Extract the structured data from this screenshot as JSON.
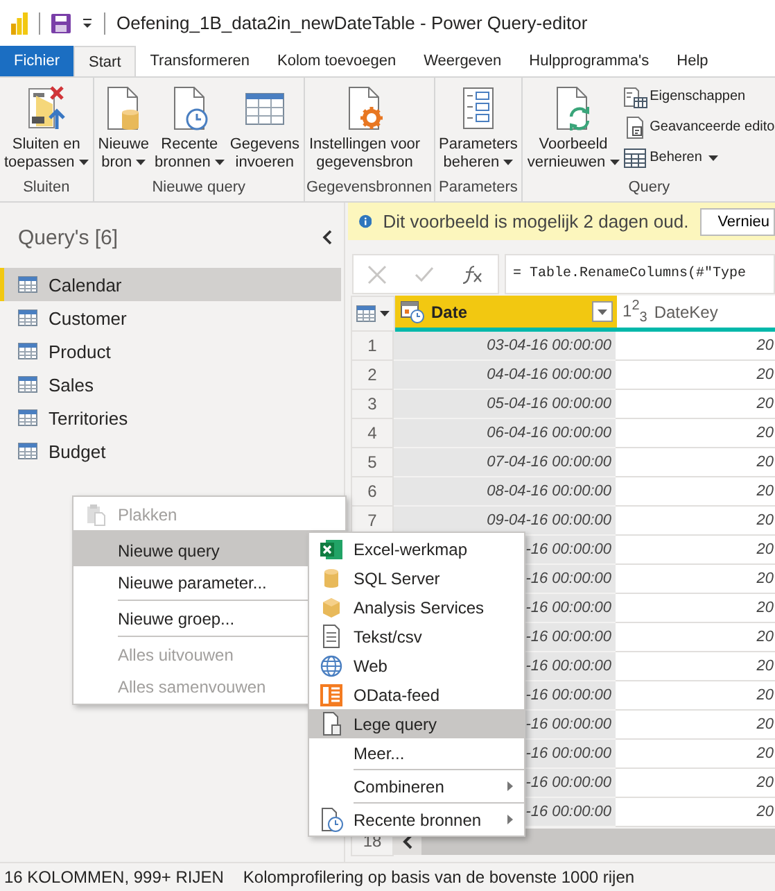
{
  "title_bar": {
    "title": "Oefening_1B_data2in_newDateTable - Power Query-editor"
  },
  "ribbon_tabs": [
    {
      "label": "Fichier",
      "kind": "file",
      "selected": false
    },
    {
      "label": "Start",
      "kind": "tab",
      "selected": true
    },
    {
      "label": "Transformeren",
      "kind": "tab",
      "selected": false
    },
    {
      "label": "Kolom toevoegen",
      "kind": "tab",
      "selected": false
    },
    {
      "label": "Weergeven",
      "kind": "tab",
      "selected": false
    },
    {
      "label": "Hulpprogramma's",
      "kind": "tab",
      "selected": false
    },
    {
      "label": "Help",
      "kind": "tab",
      "selected": false
    }
  ],
  "ribbon_groups": [
    {
      "label": "Sluiten",
      "buttons": [
        {
          "lines": [
            "Sluiten en",
            "toepassen"
          ],
          "kind": "apply",
          "dropdown": true
        }
      ]
    },
    {
      "label": "Nieuwe query",
      "buttons": [
        {
          "lines": [
            "Nieuwe",
            "bron"
          ],
          "kind": "source",
          "dropdown": true
        },
        {
          "lines": [
            "Recente",
            "bronnen"
          ],
          "kind": "recent",
          "dropdown": true
        },
        {
          "lines": [
            "Gegevens",
            "invoeren"
          ],
          "kind": "table"
        }
      ]
    },
    {
      "label": "Gegevensbronnen",
      "buttons": [
        {
          "lines": [
            "Instellingen voor",
            "gegevensbron"
          ],
          "kind": "settings"
        }
      ]
    },
    {
      "label": "Parameters",
      "buttons": [
        {
          "lines": [
            "Parameters",
            "beheren"
          ],
          "kind": "parameters",
          "dropdown": true
        }
      ]
    },
    {
      "label": "Query",
      "buttons": [
        {
          "lines": [
            "Voorbeeld",
            "vernieuwen"
          ],
          "kind": "refresh",
          "dropdown": true
        }
      ],
      "small_buttons": [
        {
          "label": "Eigenschappen",
          "kind": "properties"
        },
        {
          "label": "Geavanceerde edito",
          "kind": "editor"
        },
        {
          "label": "Beheren",
          "kind": "manage",
          "dropdown": true
        }
      ]
    }
  ],
  "queries_pane": {
    "title": "Query's [6]",
    "items": [
      {
        "label": "Calendar",
        "selected": true
      },
      {
        "label": "Customer",
        "selected": false
      },
      {
        "label": "Product",
        "selected": false
      },
      {
        "label": "Sales",
        "selected": false
      },
      {
        "label": "Territories",
        "selected": false
      },
      {
        "label": "Budget",
        "selected": false
      }
    ]
  },
  "info_bar": {
    "message": "Dit voorbeeld is mogelijk 2 dagen oud.",
    "button": "Vernieu"
  },
  "formula_bar": {
    "formula": "= Table.RenameColumns(#\"Type"
  },
  "table": {
    "columns": [
      {
        "title": "Date",
        "kind": "datetime",
        "selected": true
      },
      {
        "title": "DateKey",
        "type_label": "1$^{2}$$_{3}$",
        "kind": "number",
        "selected": false
      }
    ],
    "rows": [
      {
        "number": "1",
        "date": "03-04-16 00:00:00",
        "datekey": "20"
      },
      {
        "number": "2",
        "date": "04-04-16 00:00:00",
        "datekey": "20"
      },
      {
        "number": "3",
        "date": "05-04-16 00:00:00",
        "datekey": "20"
      },
      {
        "number": "4",
        "date": "06-04-16 00:00:00",
        "datekey": "20"
      },
      {
        "number": "5",
        "date": "07-04-16 00:00:00",
        "datekey": "20"
      },
      {
        "number": "6",
        "date": "08-04-16 00:00:00",
        "datekey": "20"
      },
      {
        "number": "7",
        "date": "09-04-16 00:00:00",
        "datekey": "20"
      },
      {
        "date": "-16 00:00:00",
        "datekey": "20"
      },
      {
        "date": "-16 00:00:00",
        "datekey": "20"
      },
      {
        "date": "-16 00:00:00",
        "datekey": "20"
      },
      {
        "date": "-16 00:00:00",
        "datekey": "20"
      },
      {
        "date": "-16 00:00:00",
        "datekey": "20"
      },
      {
        "date": "-16 00:00:00",
        "datekey": "20"
      },
      {
        "date": "-16 00:00:00",
        "datekey": "20"
      },
      {
        "date": "-16 00:00:00",
        "datekey": "20"
      },
      {
        "date": "-16 00:00:00",
        "datekey": "20"
      },
      {
        "date": "-16 00:00:00",
        "datekey": "20"
      }
    ],
    "last_row_number": "18"
  },
  "context_menu": {
    "items": [
      {
        "label": "Plakken",
        "kind": "paste",
        "disabled": true,
        "highlighted": false
      },
      {
        "label": "Nieuwe query",
        "kind": "plain",
        "disabled": false,
        "highlighted": true,
        "submenu": true,
        "separator": true
      },
      {
        "label": "Nieuwe parameter...",
        "kind": "plain",
        "disabled": false,
        "highlighted": false
      },
      {
        "label": "Nieuwe groep...",
        "kind": "plain",
        "disabled": false,
        "highlighted": false,
        "separator": true
      },
      {
        "label": "Alles uitvouwen",
        "kind": "plain",
        "disabled": true,
        "highlighted": false,
        "separator": true
      },
      {
        "label": "Alles samenvouwen",
        "kind": "plain",
        "disabled": true,
        "highlighted": false
      }
    ]
  },
  "submenu": {
    "items": [
      {
        "label": "Excel-werkmap",
        "kind": "excel",
        "highlighted": false
      },
      {
        "label": "SQL Server",
        "kind": "database",
        "highlighted": false
      },
      {
        "label": "Analysis Services",
        "kind": "cube",
        "highlighted": false
      },
      {
        "label": "Tekst/csv",
        "kind": "document",
        "highlighted": false
      },
      {
        "label": "Web",
        "kind": "globe",
        "highlighted": false
      },
      {
        "label": "OData-feed",
        "kind": "odata",
        "highlighted": false
      },
      {
        "label": "Lege query",
        "kind": "blank",
        "highlighted": true
      },
      {
        "label": "Meer...",
        "kind": "plain",
        "highlighted": false
      },
      {
        "label": "Combineren",
        "kind": "plain",
        "highlighted": false,
        "submenu": true,
        "separator": true
      },
      {
        "label": "Recente bronnen",
        "kind": "recent",
        "highlighted": false,
        "submenu": true,
        "separator": true
      }
    ]
  },
  "status_bar": {
    "columns_info": "16 KOLOMMEN, 999+ RIJEN",
    "profiling_info": "Kolomprofilering op basis van de bovenste 1000 rijen"
  }
}
